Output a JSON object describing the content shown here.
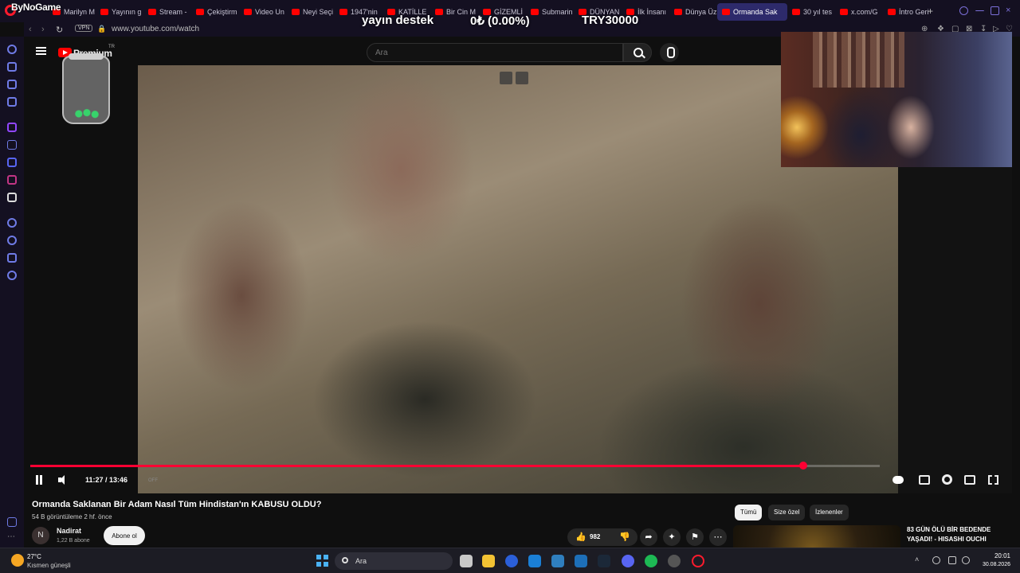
{
  "browser": {
    "tabs": [
      {
        "label": "Marilyn M"
      },
      {
        "label": "Yayının g"
      },
      {
        "label": "Stream -"
      },
      {
        "label": "Çekiştirm"
      },
      {
        "label": "Video Un"
      },
      {
        "label": "Neyi Seçi"
      },
      {
        "label": "1947'nin"
      },
      {
        "label": "KATİLLE"
      },
      {
        "label": "Bir Cin M"
      },
      {
        "label": "GİZEMLİ"
      },
      {
        "label": "Submarin"
      },
      {
        "label": "DÜNYAN"
      },
      {
        "label": "İlk İnsanı"
      },
      {
        "label": "Dünya Üz"
      },
      {
        "label": "Ormanda Sak",
        "active": true
      },
      {
        "label": "30 yıl tes"
      },
      {
        "label": "x.com/G"
      },
      {
        "label": "İntro Geri"
      }
    ],
    "add_tab": "+",
    "vpn_label": "VPN",
    "url": "www.youtube.com/watch"
  },
  "stream_overlay": {
    "brand": "ByNoGame",
    "donation_label": "yayın destek",
    "donation_progress": "0₺ (0.00%)",
    "donation_goal": "TRY30000"
  },
  "youtube": {
    "logo_text": "Premium",
    "region": "TR",
    "search_placeholder": "Ara",
    "player": {
      "time": "11:27 / 13:46",
      "progress": 0.91,
      "cc_label": "OFF"
    },
    "video": {
      "title": "Ormanda Saklanan Bir Adam Nasıl Tüm Hindistan'ın KABUSU OLDU?",
      "meta": "54 B görüntüleme  2 hf. önce",
      "channel_initial": "N",
      "channel_name": "Nadirat",
      "channel_subs": "1,22 B abone",
      "subscribe_label": "Abone ol",
      "like_count": "982"
    },
    "chips": [
      {
        "label": "Tümü",
        "active": true
      },
      {
        "label": "Size özel"
      },
      {
        "label": "İzlenenler"
      }
    ],
    "recommendation": {
      "title": "83 GÜN ÖLÜ BİR BEDENDE YAŞADI! - HISASHI OUCHI"
    }
  },
  "taskbar": {
    "weather_temp": "27°C",
    "weather_desc": "Kısmen güneşli",
    "search_label": "Ara",
    "time": "20:01",
    "date": "30.08.2026"
  },
  "colors": {
    "progress": "#ff0033",
    "youtube_red": "#ff0000",
    "browser_bg": "#141021"
  }
}
